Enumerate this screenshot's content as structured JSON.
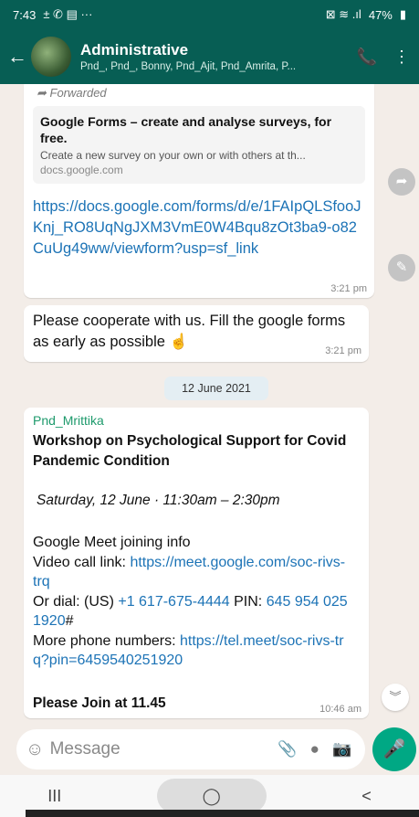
{
  "status": {
    "time": "7:43",
    "icons_left": "± ✆ ▤ ···",
    "signal": "⊠ ≋ .ıl",
    "battery": "47%"
  },
  "header": {
    "title": "Administrative",
    "members": "Pnd_, Pnd_, Bonny, Pnd_Ajit, Pnd_Amrita, P..."
  },
  "messages": [
    {
      "forwarded_label": "Forwarded",
      "preview_title": "Google Forms – create and analyse surveys, for free.",
      "preview_desc": "Create a new survey on your own or with others at th...",
      "preview_domain": "docs.google.com",
      "link": "https://docs.google.com/forms/d/e/1FAIpQLSfooJKnj_RO8UqNgJXM3VmE0W4Bqu8zOt3ba9-o82CuUg49ww/viewform?usp=sf_link",
      "time": "3:21 pm"
    },
    {
      "text": "Please cooperate with us. Fill the google forms as early as possible ☝",
      "time": "3:21 pm"
    },
    {
      "sender": "Pnd_Mrittika",
      "title": "Workshop on Psychological Support for Covid Pandemic Condition",
      "when": "Saturday, 12 June · 11:30am – 2:30pm",
      "meet_info": "Google Meet joining info",
      "video_label": "Video call link: ",
      "video_link": "https://meet.google.com/soc-rivs-trq",
      "dial_label": "Or dial: (US) ",
      "dial_number": "+1 617-675-4444",
      "pin_label": " PIN: ",
      "pin": "645 954 025 1920",
      "pin_suffix": "#",
      "more_label": "More phone numbers: ",
      "more_link": "https://tel.meet/soc-rivs-trq?pin=6459540251920",
      "join": "Please Join at 11.45",
      "time": "10:46 am"
    }
  ],
  "date_separator": "12 June 2021",
  "input": {
    "placeholder": "Message"
  },
  "nav": {
    "recents": "III",
    "home": "◯",
    "back": "<"
  }
}
